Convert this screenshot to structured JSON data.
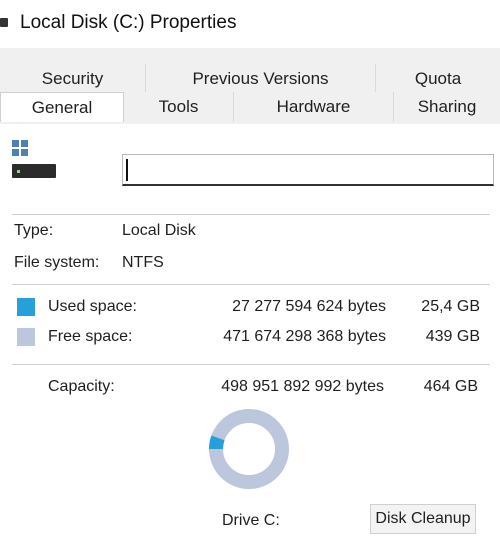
{
  "window": {
    "title": "Local Disk (C:) Properties"
  },
  "tabs": {
    "row1": [
      {
        "label": "Security"
      },
      {
        "label": "Previous Versions"
      },
      {
        "label": "Quota"
      }
    ],
    "row2": [
      {
        "label": "General",
        "active": true
      },
      {
        "label": "Tools"
      },
      {
        "label": "Hardware"
      },
      {
        "label": "Sharing"
      }
    ]
  },
  "general": {
    "volume_label_value": "",
    "type_label": "Type:",
    "type_value": "Local Disk",
    "fs_label": "File system:",
    "fs_value": "NTFS",
    "used": {
      "label": "Used space:",
      "bytes": "27 277 594 624 bytes",
      "size": "25,4 GB",
      "color": "#26a0da"
    },
    "free": {
      "label": "Free space:",
      "bytes": "471 674 298 368 bytes",
      "size": "439 GB",
      "color": "#bcc6dd"
    },
    "capacity": {
      "label": "Capacity:",
      "bytes": "498 951 892 992 bytes",
      "size": "464 GB"
    },
    "used_fraction": 0.055,
    "drive_label": "Drive C:",
    "cleanup_label": "Disk Cleanup"
  }
}
